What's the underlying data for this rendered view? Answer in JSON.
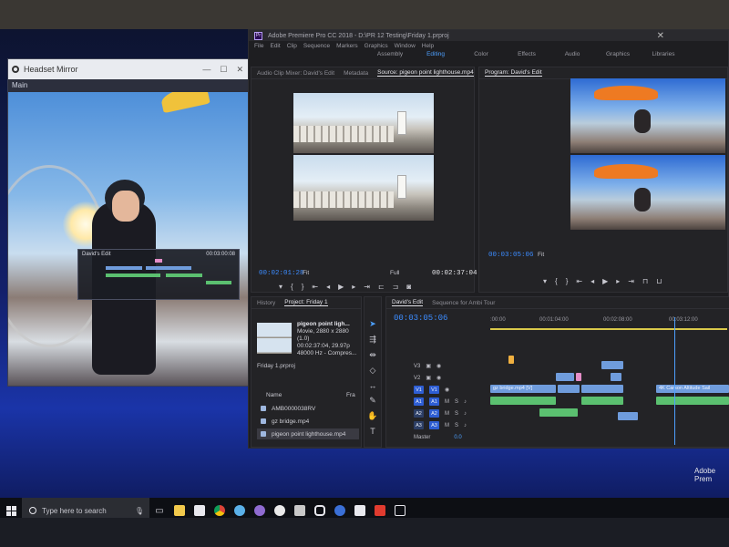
{
  "headset_mirror": {
    "title": "Headset Mirror",
    "tab": "Main",
    "mini_timeline": {
      "title": "David's Edit",
      "timecode": "00:03:00:08"
    }
  },
  "premiere": {
    "title": "Adobe Premiere Pro CC 2018 - D:\\PR 12 Testing\\Friday 1.prproj",
    "menus": [
      "File",
      "Edit",
      "Clip",
      "Sequence",
      "Markers",
      "Graphics",
      "Window",
      "Help"
    ],
    "workspaces": [
      {
        "label": "Assembly",
        "active": false
      },
      {
        "label": "Editing",
        "active": true
      },
      {
        "label": "Color",
        "active": false
      },
      {
        "label": "Effects",
        "active": false
      },
      {
        "label": "Audio",
        "active": false
      },
      {
        "label": "Graphics",
        "active": false
      },
      {
        "label": "Libraries",
        "active": false
      }
    ],
    "source_panel": {
      "tabs": [
        "Audio Clip Mixer: David's Edit",
        "Metadata",
        "Source: pigeon point lighthouse.mp4"
      ],
      "current_time": "00:02:01:28",
      "duration": "00:02:37:04",
      "fit": "Fit",
      "resolution": "Full"
    },
    "program_panel": {
      "tab": "Program: David's Edit",
      "current_time": "00:03:05:06",
      "fit": "Fit"
    },
    "project_panel": {
      "tabs": [
        "History",
        "Project: Friday 1"
      ],
      "clip_info": {
        "name": "pigeon point ligh...",
        "line1": "Movie, 2880 x 2880 (1.0)",
        "line2": "00:02:37:04, 29.97p",
        "line3": "48000 Hz - Compres..."
      },
      "project_file": "Friday 1.prproj",
      "columns": [
        "Name",
        "Fra"
      ],
      "items": [
        {
          "name": "AMB0000038RV",
          "selected": false
        },
        {
          "name": "gz bridge.mp4",
          "selected": false
        },
        {
          "name": "pigeon point lighthouse.mp4",
          "selected": true
        }
      ]
    },
    "timeline": {
      "tab": "David's Edit",
      "sequence_tab": "Sequence for Ambi Tour",
      "timecode": "00:03:05:06",
      "ruler": [
        ":00:00",
        "00:01:04:00",
        "00:02:08:00",
        "00:03:12:00"
      ],
      "video_tracks": [
        "V3",
        "V2",
        "V1"
      ],
      "audio_tracks": [
        "A1",
        "A2",
        "A3"
      ],
      "master": {
        "label": "Master",
        "value": "0.0"
      },
      "clips": {
        "gz_bridge": "gz bridge.mp4 [V]",
        "carson": "4K Carson Altitude Sail"
      }
    }
  },
  "taskbar": {
    "search_placeholder": "Type here to search"
  },
  "corner_label": "Adobe Prem"
}
